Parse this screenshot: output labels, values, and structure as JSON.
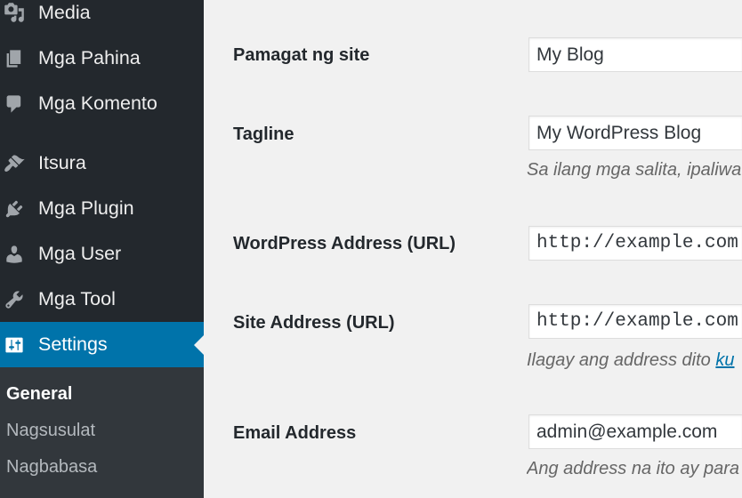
{
  "sidebar": {
    "menu": [
      {
        "label": "Media",
        "icon": "media-icon"
      },
      {
        "label": "Mga Pahina",
        "icon": "pages-icon"
      },
      {
        "label": "Mga Komento",
        "icon": "comments-icon"
      },
      {
        "label": "Itsura",
        "icon": "appearance-icon"
      },
      {
        "label": "Mga Plugin",
        "icon": "plugins-icon"
      },
      {
        "label": "Mga User",
        "icon": "users-icon"
      },
      {
        "label": "Mga Tool",
        "icon": "tools-icon"
      },
      {
        "label": "Settings",
        "icon": "settings-icon",
        "current": true
      }
    ],
    "submenu": [
      {
        "label": "General",
        "current": true
      },
      {
        "label": "Nagsusulat"
      },
      {
        "label": "Nagbabasa"
      }
    ]
  },
  "form": {
    "site_title": {
      "label": "Pamagat ng site",
      "value": "My Blog"
    },
    "tagline": {
      "label": "Tagline",
      "value": "My WordPress Blog",
      "description": "Sa ilang mga salita, ipaliwa"
    },
    "wordpress_address": {
      "label": "WordPress Address (URL)",
      "value": "http://example.com"
    },
    "site_address": {
      "label": "Site Address (URL)",
      "value": "http://example.com",
      "description": "Ilagay ang address dito",
      "description_link": "ku"
    },
    "email_address": {
      "label": "Email Address",
      "value": "admin@example.com",
      "description": "Ang address na ito ay para"
    }
  },
  "colors": {
    "sidebar_bg": "#23282d",
    "submenu_bg": "#32373c",
    "content_bg": "#f1f1f1",
    "accent": "#0073aa",
    "link": "#0073aa",
    "menu_text": "#eeeeee",
    "menu_icon": "#a0a5aa",
    "submenu_text": "#b4b9be"
  }
}
